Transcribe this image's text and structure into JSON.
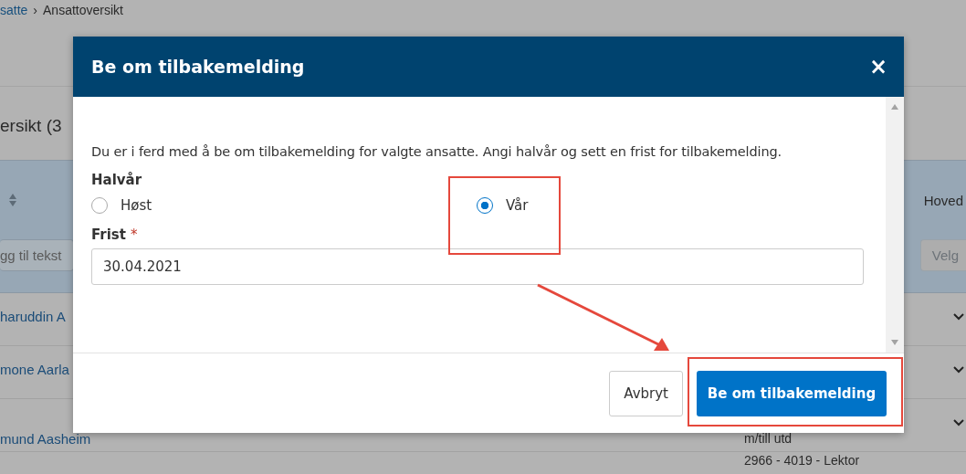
{
  "breadcrumb": {
    "link": "satte",
    "separator": "›",
    "current": "Ansattoversikt"
  },
  "page_heading": "ersikt (3",
  "table": {
    "header_right": "Hoved",
    "filter_placeholder": "gg til tekst",
    "select_placeholder": "Velg",
    "rows": [
      {
        "name": "haruddin A",
        "note": ""
      },
      {
        "name": "mone Aarla",
        "note": ""
      },
      {
        "name": "mund Aasheim",
        "note": "m/till utd"
      },
      {
        "name": "",
        "note": "2966 - 4019 - Lektor"
      }
    ]
  },
  "dialog": {
    "title": "Be om tilbakemelding",
    "close": "×",
    "intro": "Du er i ferd med å be om tilbakemelding for valgte ansatte. Angi halvår og sett en frist for tilbakemelding.",
    "halfyear_label": "Halvår",
    "options": [
      {
        "label": "Høst",
        "selected": false
      },
      {
        "label": "Vår",
        "selected": true
      }
    ],
    "deadline_label": "Frist",
    "required_mark": "*",
    "deadline_value": "30.04.2021",
    "cancel": "Avbryt",
    "submit": "Be om tilbakemelding"
  }
}
